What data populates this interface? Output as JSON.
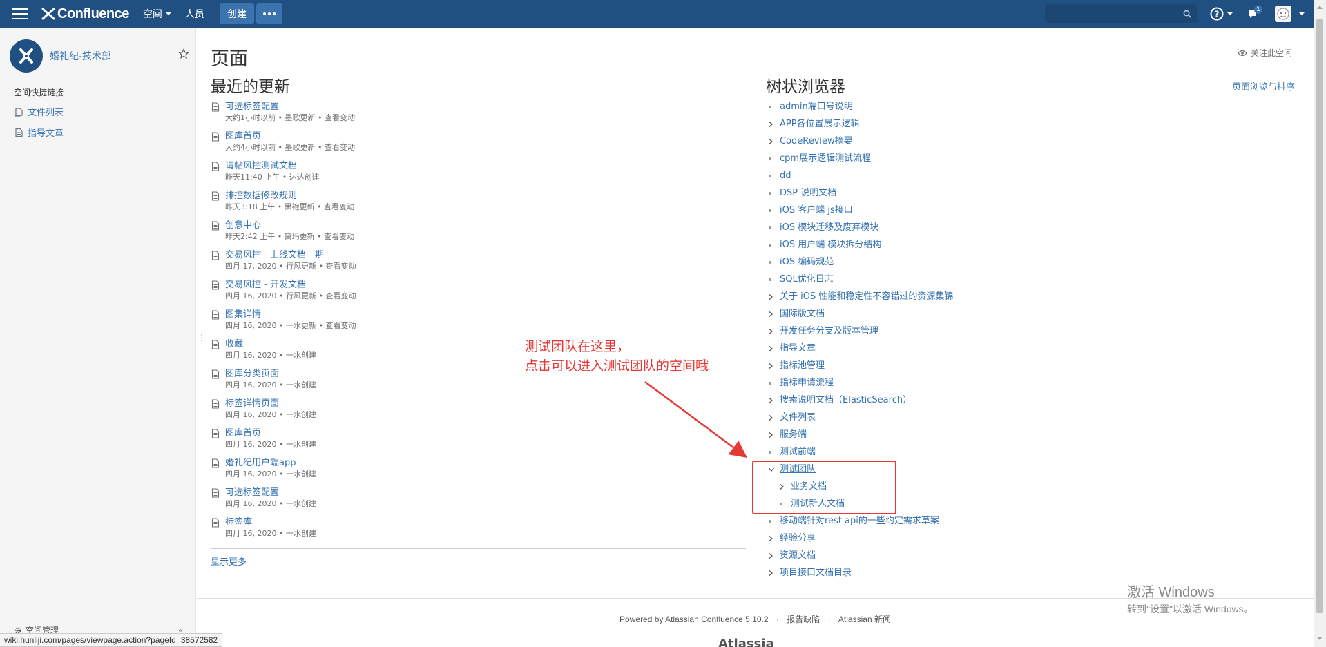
{
  "header": {
    "logo_text": "Confluence",
    "nav_spaces": "空间",
    "nav_people": "人员",
    "create_label": "创建",
    "search_placeholder": ""
  },
  "colors": {
    "header_bg": "#205081",
    "link": "#3572b0",
    "annotation": "#e53935"
  },
  "sidebar": {
    "space_name": "婚礼纪-技术部",
    "shortcuts_title": "空间快捷链接",
    "links": [
      {
        "label": "文件列表",
        "icon": "file-list-icon"
      },
      {
        "label": "指导文章",
        "icon": "page-icon"
      }
    ],
    "space_admin": "空间管理"
  },
  "main": {
    "page_title": "页面",
    "watch_label": "关注此空间",
    "recent_title": "最近的更新",
    "tree_title": "树状浏览器",
    "browse_link": "页面浏览与排序",
    "show_more": "显示更多",
    "recent": [
      {
        "title": "可选标签配置",
        "meta": "大约1小时以前 • 墨歌更新 • 查看变动"
      },
      {
        "title": "图库首页",
        "meta": "大约4小时以前 • 墨歌更新 • 查看变动"
      },
      {
        "title": "请帖风控测试文档",
        "meta": "昨天11:40 上午 • 达达创建"
      },
      {
        "title": "排控数据修改规则",
        "meta": "昨天3:18 上午 • 黑袍更新 • 查看变动"
      },
      {
        "title": "创意中心",
        "meta": "昨天2:42 上午 • 黛玛更新 • 查看变动"
      },
      {
        "title": "交易风控 - 上线文档—期",
        "meta": "四月 17, 2020 • 行风更新 • 查看变动"
      },
      {
        "title": "交易风控 - 开发文档",
        "meta": "四月 16, 2020 • 行风更新 • 查看变动"
      },
      {
        "title": "图集详情",
        "meta": "四月 16, 2020 • 一水更新 • 查看变动"
      },
      {
        "title": "收藏",
        "meta": "四月 16, 2020 • 一水创建"
      },
      {
        "title": "图库分类页面",
        "meta": "四月 16, 2020 • 一水创建"
      },
      {
        "title": "标签详情页面",
        "meta": "四月 16, 2020 • 一水创建"
      },
      {
        "title": "图库首页",
        "meta": "四月 16, 2020 • 一水创建"
      },
      {
        "title": "婚礼纪用户端app",
        "meta": "四月 16, 2020 • 一水创建"
      },
      {
        "title": "可选标签配置",
        "meta": "四月 16, 2020 • 一水创建"
      },
      {
        "title": "标签库",
        "meta": "四月 16, 2020 • 一水创建"
      }
    ],
    "tree": [
      {
        "label": "admin端口号说明",
        "marker": "bullet"
      },
      {
        "label": "APP各位置展示逻辑",
        "marker": "chevron"
      },
      {
        "label": "CodeReview摘要",
        "marker": "chevron"
      },
      {
        "label": "cpm展示逻辑测试流程",
        "marker": "bullet"
      },
      {
        "label": "dd",
        "marker": "bullet"
      },
      {
        "label": "DSP 说明文档",
        "marker": "bullet"
      },
      {
        "label": "iOS 客户端 js接口",
        "marker": "bullet"
      },
      {
        "label": "iOS 模块迁移及废弃模块",
        "marker": "bullet"
      },
      {
        "label": "iOS 用户端 模块拆分结构",
        "marker": "bullet"
      },
      {
        "label": "iOS 编码规范",
        "marker": "bullet"
      },
      {
        "label": "SQL优化日志",
        "marker": "bullet"
      },
      {
        "label": "关于 iOS 性能和稳定性不容错过的资源集锦",
        "marker": "chevron"
      },
      {
        "label": "国际版文档",
        "marker": "chevron"
      },
      {
        "label": "开发任务分支及版本管理",
        "marker": "chevron"
      },
      {
        "label": "指导文章",
        "marker": "chevron"
      },
      {
        "label": "指标池管理",
        "marker": "chevron"
      },
      {
        "label": "指标申请流程",
        "marker": "bullet"
      },
      {
        "label": "搜索说明文档（ElasticSearch）",
        "marker": "chevron"
      },
      {
        "label": "文件列表",
        "marker": "chevron"
      },
      {
        "label": "服务端",
        "marker": "chevron"
      },
      {
        "label": "测试前端",
        "marker": "bullet"
      },
      {
        "label": "测试团队",
        "marker": "expanded",
        "current": true
      },
      {
        "label": "业务文档",
        "marker": "chevron",
        "child": true
      },
      {
        "label": "测试新人文档",
        "marker": "bullet",
        "child": true
      },
      {
        "label": "移动端针对rest api的一些约定需求草案",
        "marker": "bullet"
      },
      {
        "label": "经验分享",
        "marker": "chevron"
      },
      {
        "label": "资源文档",
        "marker": "chevron"
      },
      {
        "label": "项目接口文档目录",
        "marker": "chevron"
      }
    ]
  },
  "annotation": {
    "line1": "测试团队在这里，",
    "line2": "点击可以进入测试团队的空间哦"
  },
  "footer": {
    "powered": "Powered by Atlassian Confluence 5.10.2",
    "report": "报告缺陷",
    "news": "Atlassian 新闻",
    "logo_text": "Atlassian"
  },
  "windows_watermark": {
    "line1": "激活 Windows",
    "line2": "转到\"设置\"以激活 Windows。"
  },
  "statusbar": {
    "url": "wiki.hunliji.com/pages/viewpage.action?pageId=38572582"
  }
}
